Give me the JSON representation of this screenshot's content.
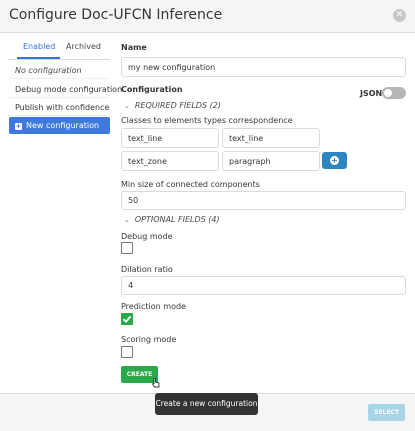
{
  "modal": {
    "title": "Configure Doc-UFCN Inference",
    "close_icon": "close-icon"
  },
  "tabs": [
    {
      "label": "Enabled",
      "active": true
    },
    {
      "label": "Archived",
      "active": false
    }
  ],
  "sidebar": {
    "empty_text": "No configuration",
    "items": [
      {
        "label": "Debug mode configuration"
      },
      {
        "label": "Publish with confidence"
      }
    ],
    "new_item_label": "New configuration"
  },
  "form": {
    "name_label": "Name",
    "name_value": "my new configuration",
    "configuration_label": "Configuration",
    "json_label": "JSON",
    "json_enabled": false,
    "required_toggle": "REQUIRED FIELDS (2)",
    "classes_label": "Classes to elements types correspondence",
    "class_rows": [
      {
        "class": "text_line",
        "type": "text_line"
      },
      {
        "class": "text_zone",
        "type": "paragraph"
      }
    ],
    "min_size_label": "Min size of connected components",
    "min_size_value": "50",
    "optional_toggle": "OPTIONAL FIELDS (4)",
    "debug_label": "Debug mode",
    "debug_checked": false,
    "dilation_label": "Dilation ratio",
    "dilation_value": "4",
    "prediction_label": "Prediction mode",
    "prediction_checked": true,
    "scoring_label": "Scoring mode",
    "scoring_checked": false,
    "create_label": "CREATE"
  },
  "tooltip": "Create a new configuration",
  "footer": {
    "select_label": "SELECT"
  },
  "colors": {
    "accent": "#3273dc",
    "success": "#2ba84a",
    "info": "#2e86c1"
  }
}
